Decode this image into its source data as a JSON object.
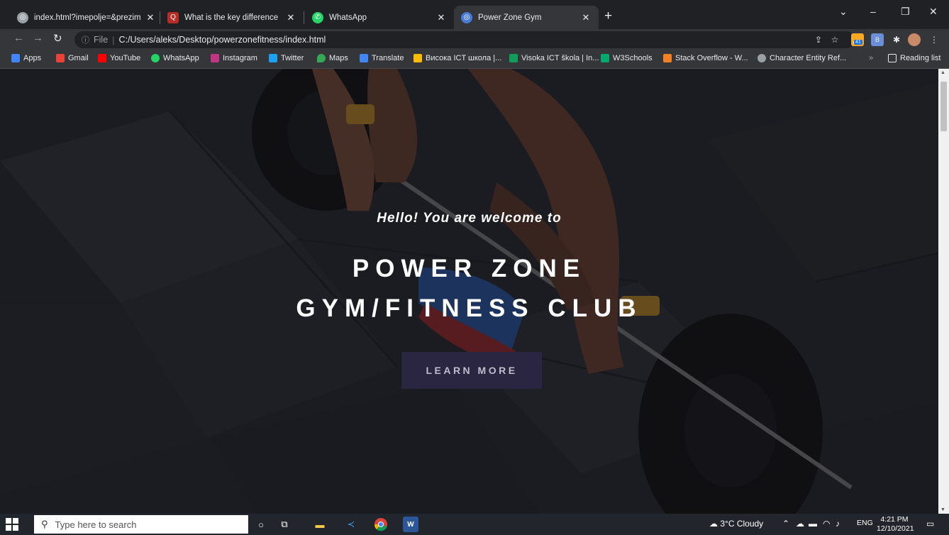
{
  "browser": {
    "tabs": [
      {
        "title": "index.html?imepolje=&prezimep",
        "active": false
      },
      {
        "title": "What is the key difference betwe",
        "active": false
      },
      {
        "title": "WhatsApp",
        "active": false
      },
      {
        "title": "Power Zone Gym",
        "active": true
      }
    ],
    "new_tab_label": "+",
    "address": {
      "scheme_label": "File",
      "url": "C:/Users/aleks/Desktop/powerzonefitness/index.html"
    },
    "extension_badge": "41",
    "bookmarks": [
      {
        "label": "Apps",
        "color": "#4285f4"
      },
      {
        "label": "Gmail",
        "color": "#ea4335"
      },
      {
        "label": "YouTube",
        "color": "#ff0000"
      },
      {
        "label": "WhatsApp",
        "color": "#25d366"
      },
      {
        "label": "Instagram",
        "color": "#c13584"
      },
      {
        "label": "Twitter",
        "color": "#1da1f2"
      },
      {
        "label": "Maps",
        "color": "#34a853"
      },
      {
        "label": "Translate",
        "color": "#4285f4"
      },
      {
        "label": "Висока ICT школа |...",
        "color": "#fbbc05"
      },
      {
        "label": "Visoka ICT škola | In...",
        "color": "#0f9d58"
      },
      {
        "label": "W3Schools",
        "color": "#04aa6d"
      },
      {
        "label": "Stack Overflow - W...",
        "color": "#f48024"
      },
      {
        "label": "Character Entity Ref...",
        "color": "#9aa0a6"
      }
    ],
    "bookmarks_overflow": "»",
    "reading_list_label": "Reading list"
  },
  "page": {
    "greeting": "Hello! You are welcome to",
    "title_line1": "POWER ZONE",
    "title_line2": "GYM/FITNESS CLUB",
    "cta_label": "LEARN MORE"
  },
  "taskbar": {
    "search_placeholder": "Type here to search",
    "weather": "3°C  Cloudy",
    "language": "ENG",
    "time": "4:21 PM",
    "date": "12/10/2021"
  }
}
